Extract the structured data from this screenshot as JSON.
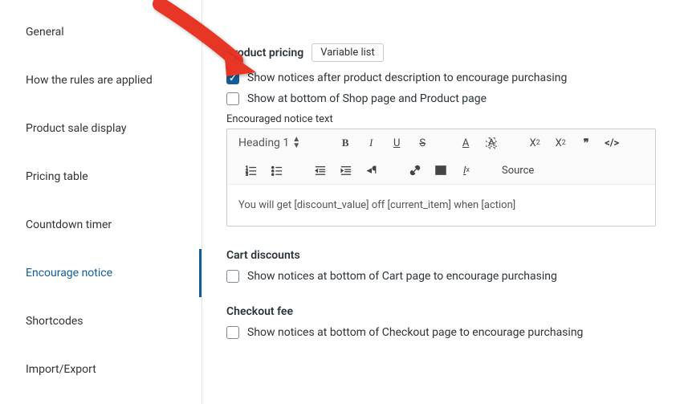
{
  "sidebar": {
    "items": [
      {
        "label": "General"
      },
      {
        "label": "How the rules are applied"
      },
      {
        "label": "Product sale display"
      },
      {
        "label": "Pricing table"
      },
      {
        "label": "Countdown timer"
      },
      {
        "label": "Encourage notice"
      },
      {
        "label": "Shortcodes"
      },
      {
        "label": "Import/Export"
      }
    ]
  },
  "productPricing": {
    "title": "Product pricing",
    "chip": "Variable list",
    "check1": "Show notices after product description to encourage purchasing",
    "check2": "Show at bottom of Shop page and Product page",
    "noticeLabel": "Encouraged notice text",
    "toolbar": {
      "heading": "Heading 1",
      "source": "Source"
    },
    "noticeBody": "You will get [discount_value] off [current_item] when [action]"
  },
  "cartDiscounts": {
    "title": "Cart discounts",
    "check1": "Show notices at bottom of Cart page to encourage purchasing"
  },
  "checkoutFee": {
    "title": "Checkout fee",
    "check1": "Show notices at bottom of Checkout page to encourage purchasing"
  }
}
